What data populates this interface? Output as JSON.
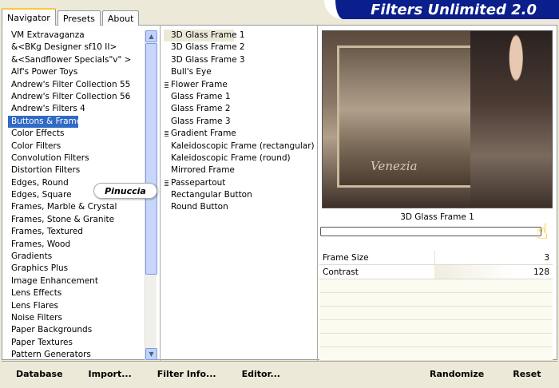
{
  "tabs": [
    "Navigator",
    "Presets",
    "About"
  ],
  "app_title": "Filters Unlimited 2.0",
  "categories": [
    "VM Extravaganza",
    "&<BKg Designer sf10 II>",
    "&<Sandflower Specials\"v\" >",
    "Alf's Power Toys",
    "Andrew's Filter Collection 55",
    "Andrew's Filter Collection 56",
    "Andrew's Filters 4",
    "Buttons & Frames",
    "Color Effects",
    "Color Filters",
    "Convolution Filters",
    "Distortion Filters",
    "Edges, Round",
    "Edges, Square",
    "Frames, Marble & Crystal",
    "Frames, Stone & Granite",
    "Frames, Textured",
    "Frames, Wood",
    "Gradients",
    "Graphics Plus",
    "Image Enhancement",
    "Lens Effects",
    "Lens Flares",
    "Noise Filters",
    "Paper Backgrounds",
    "Paper Textures",
    "Pattern Generators"
  ],
  "selected_category": "Buttons & Frames",
  "filters": [
    {
      "label": "3D Glass Frame 1",
      "group": false
    },
    {
      "label": "3D Glass Frame 2",
      "group": false
    },
    {
      "label": "3D Glass Frame 3",
      "group": false
    },
    {
      "label": "Bull's Eye",
      "group": false
    },
    {
      "label": "Flower Frame",
      "group": true
    },
    {
      "label": "Glass Frame 1",
      "group": false
    },
    {
      "label": "Glass Frame 2",
      "group": false
    },
    {
      "label": "Glass Frame 3",
      "group": false
    },
    {
      "label": "Gradient Frame",
      "group": true
    },
    {
      "label": "Kaleidoscopic Frame (rectangular)",
      "group": false
    },
    {
      "label": "Kaleidoscopic Frame (round)",
      "group": false
    },
    {
      "label": "Mirrored Frame",
      "group": false
    },
    {
      "label": "Passepartout",
      "group": true
    },
    {
      "label": "Rectangular Button",
      "group": false
    },
    {
      "label": "Round Button",
      "group": false
    }
  ],
  "selected_filter": "3D Glass Frame 1",
  "preview": {
    "caption": "3D Glass Frame 1",
    "image_text": "Venezia"
  },
  "watermark": "Pinuccia",
  "params": [
    {
      "name": "Frame Size",
      "value": "3"
    },
    {
      "name": "Contrast",
      "value": "128"
    }
  ],
  "buttons": {
    "database": "Database",
    "import": "Import...",
    "filter_info": "Filter Info...",
    "editor": "Editor...",
    "randomize": "Randomize",
    "reset": "Reset"
  },
  "colors": {
    "selection": "#316ac5",
    "banner": "#0a1e8c",
    "tab_highlight": "#ffc83c"
  }
}
